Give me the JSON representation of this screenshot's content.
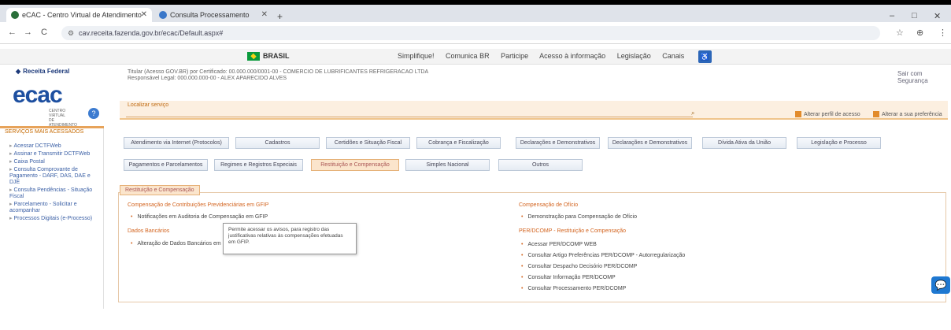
{
  "browser": {
    "tabs": [
      {
        "title": "eCAC - Centro Virtual de Atendimento",
        "active": true
      },
      {
        "title": "Consulta Processamento",
        "active": false
      }
    ],
    "url": "cav.receita.fazenda.gov.br/ecac/Default.aspx#",
    "new_tab": "+",
    "back": "←",
    "forward": "→",
    "reload": "C",
    "minimize": "–",
    "maximize": "□",
    "close": "✕",
    "bookmark": "☆",
    "profile": "⊕",
    "menu": "⋮"
  },
  "govbar": {
    "country": "BRASIL",
    "links": [
      "Simplifique!",
      "Comunica BR",
      "Participe",
      "Acesso à informação",
      "Legislação",
      "Canais"
    ]
  },
  "header": {
    "rf_logo": "Receita Federal",
    "ecac": "ecac",
    "ecac_sub": "CENTRO VIRTUAL DE ATENDIMENTO",
    "info_line1": "Titular (Acesso GOV.BR) por Certificado: 00.000.000/0001-00 - COMERCIO DE LUBRIFICANTES REFRIGERACAO LTDA",
    "info_line2": "Responsável Legal: 000.000.000-00 - ALEX APARECIDO ALVES",
    "top_right": "Sair com Segurança",
    "banner_label": "Localizar serviço",
    "banner_act1": "Alterar perfil de acesso",
    "banner_act2": "Alterar a sua preferência"
  },
  "sidebar": {
    "title": "SERVIÇOS MAIS ACESSADOS",
    "items": [
      "Acessar DCTFWeb",
      "Assinar e Transmitir DCTFWeb",
      "Caixa Postal",
      "Consulta Comprovante de Pagamento - DARF, DAS, DAE e DJE",
      "Consulta Pendências - Situação Fiscal",
      "Parcelamento - Solicitar e acompanhar",
      "Processos Digitais (e-Processo)"
    ]
  },
  "menu": {
    "row1": [
      "Atendimento via Internet (Protocolos)",
      "Cadastros",
      "Certidões e Situação Fiscal",
      "Cobrança e Fiscalização",
      "Declarações e Demonstrativos",
      "Dívida Ativa da União",
      "Legislação e Processo",
      "Declarações e Demonstrativos"
    ],
    "row2": [
      "Pagamentos e Parcelamentos",
      "Regimes e Registros Especiais",
      "Restituição e Compensação",
      "Simples Nacional",
      "Outros"
    ]
  },
  "content": {
    "tab_label": "Restituição e Compensação",
    "left_heading1": "Compensação de Contribuições Previdenciárias em GFIP",
    "left_item1": "Notificações em Auditoria de Compensação em GFIP",
    "left_heading2": "Dados Bancários",
    "left_item2": "Alteração de Dados Bancários em GFIP",
    "tooltip": "Permite acessar os avisos, para registro das justificativas relativas às compensações efetuadas em GFIP.",
    "right_heading1": "Compensação de Ofício",
    "right_item1": "Demonstração para Compensação de Ofício",
    "right_heading2": "PER/DCOMP - Restituição e Compensação",
    "right_items": [
      "Acessar PER/DCOMP WEB",
      "Consultar Artigo Preferências PER/DCOMP - Autorregularização",
      "Consultar Despacho Decisório PER/DCOMP",
      "Consultar Informação PER/DCOMP",
      "Consultar Processamento PER/DCOMP"
    ]
  },
  "chat_icon": "💬",
  "help_icon": "?"
}
